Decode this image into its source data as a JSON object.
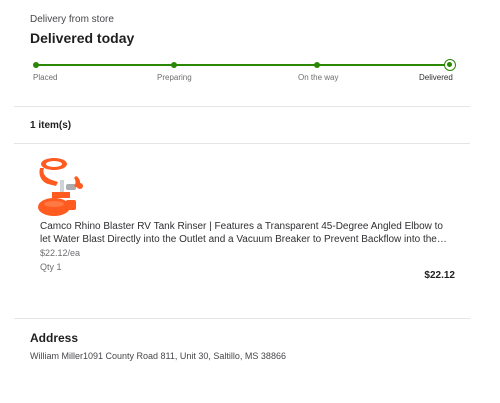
{
  "delivery": {
    "eyebrow": "Delivery from store",
    "status_title": "Delivered today"
  },
  "tracker": {
    "accent_color": "#2a8703",
    "steps": [
      {
        "label": "Placed",
        "state": "complete"
      },
      {
        "label": "Preparing",
        "state": "complete"
      },
      {
        "label": "On the way",
        "state": "complete"
      },
      {
        "label": "Delivered",
        "state": "current"
      }
    ]
  },
  "order": {
    "items_count": "1 item(s)",
    "items": [
      {
        "thumbnail_icon": "rv-tank-rinser-product-image",
        "name": "Camco Rhino Blaster RV Tank Rinser | Features a Transparent 45-Degree Angled Elbow to let Water Blast Directly into the Outlet and a Vacuum Breaker to Prevent Backflow into the Water Supply",
        "unit_price": "$22.12/ea",
        "quantity": "Qty 1",
        "total": "$22.12"
      }
    ]
  },
  "address": {
    "heading": "Address",
    "line": "William Miller1091 County Road 811, Unit 30, Saltillo, MS 38866"
  }
}
